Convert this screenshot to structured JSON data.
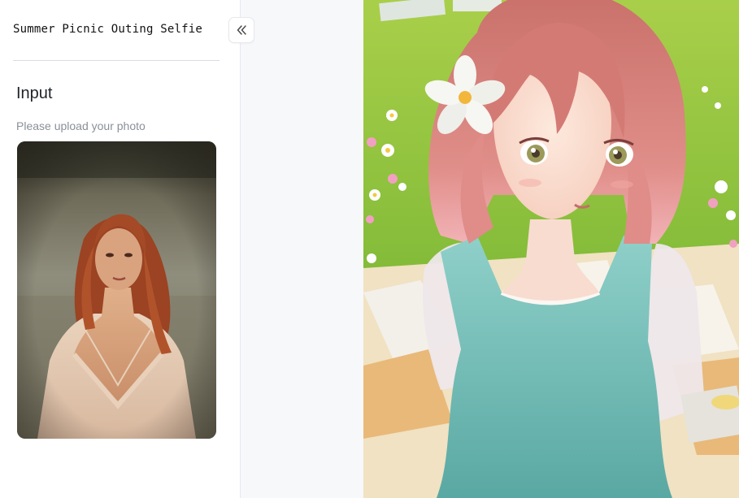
{
  "app": {
    "title": "Summer Picnic Outing Selfie"
  },
  "input_section": {
    "heading": "Input",
    "hint": "Please upload your photo",
    "uploaded_photo": "portrait-of-red-haired-woman-in-field"
  },
  "toolbar": {
    "collapse_icon": "double-chevron-left-icon"
  },
  "output": {
    "result_image": "anime-girl-picnic-illustration"
  },
  "colors": {
    "accent_text": "#1f2329",
    "hint_text": "#8a9099",
    "background": "#f7f8fa"
  }
}
